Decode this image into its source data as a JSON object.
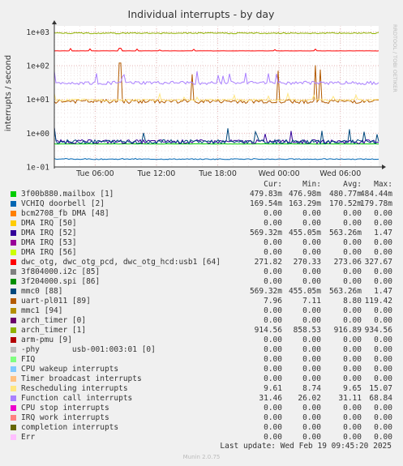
{
  "chart_data": {
    "type": "line",
    "title": "Individual interrupts - by day",
    "ylabel": "interrupts / second",
    "yscale": "log",
    "ylim": [
      0.1,
      1500
    ],
    "y_ticks": [
      "1e-01",
      "1e+00",
      "1e+01",
      "1e+02",
      "1e+03"
    ],
    "x_ticks": [
      "Tue 06:00",
      "Tue 12:00",
      "Tue 18:00",
      "Wed 00:00",
      "Wed 06:00"
    ],
    "watermark": "RRDTOOL / TOBI OETIKER",
    "grid": true,
    "columns": [
      "Cur:",
      "Min:",
      "Avg:",
      "Max:"
    ],
    "series": [
      {
        "name": "3f00b880.mailbox [1]",
        "color": "#00cc00",
        "values": [
          "479.83m",
          "476.98m",
          "480.77m",
          "484.44m"
        ]
      },
      {
        "name": "VCHIQ doorbell [2]",
        "color": "#0066b3",
        "values": [
          "169.54m",
          "163.29m",
          "170.52m",
          "179.78m"
        ]
      },
      {
        "name": "bcm2708_fb DMA [48]",
        "color": "#ff8000",
        "values": [
          "0.00",
          "0.00",
          "0.00",
          "0.00"
        ]
      },
      {
        "name": "DMA IRQ [50]",
        "color": "#ffcc00",
        "values": [
          "0.00",
          "0.00",
          "0.00",
          "0.00"
        ]
      },
      {
        "name": "DMA IRQ [52]",
        "color": "#330099",
        "values": [
          "569.32m",
          "455.05m",
          "563.26m",
          "1.47"
        ]
      },
      {
        "name": "DMA IRQ [53]",
        "color": "#990099",
        "values": [
          "0.00",
          "0.00",
          "0.00",
          "0.00"
        ]
      },
      {
        "name": "DMA IRQ [56]",
        "color": "#ccff00",
        "values": [
          "0.00",
          "0.00",
          "0.00",
          "0.00"
        ]
      },
      {
        "name": "dwc_otg, dwc_otg_pcd, dwc_otg_hcd:usb1 [64]",
        "color": "#ff0000",
        "values": [
          "271.82",
          "270.33",
          "273.06",
          "327.67"
        ]
      },
      {
        "name": "3f804000.i2c [85]",
        "color": "#808080",
        "values": [
          "0.00",
          "0.00",
          "0.00",
          "0.00"
        ]
      },
      {
        "name": "3f204000.spi [86]",
        "color": "#008f00",
        "values": [
          "0.00",
          "0.00",
          "0.00",
          "0.00"
        ]
      },
      {
        "name": "mmc0 [88]",
        "color": "#00487d",
        "values": [
          "569.32m",
          "455.05m",
          "563.26m",
          "1.47"
        ]
      },
      {
        "name": "uart-pl011 [89]",
        "color": "#b35a00",
        "values": [
          "7.96",
          "7.11",
          "8.80",
          "119.42"
        ]
      },
      {
        "name": "mmc1 [94]",
        "color": "#b38f00",
        "values": [
          "0.00",
          "0.00",
          "0.00",
          "0.00"
        ]
      },
      {
        "name": "arch_timer [0]",
        "color": "#6b006b",
        "values": [
          "0.00",
          "0.00",
          "0.00",
          "0.00"
        ]
      },
      {
        "name": "arch_timer [1]",
        "color": "#8fb300",
        "values": [
          "914.56",
          "858.53",
          "916.89",
          "934.56"
        ]
      },
      {
        "name": "arm-pmu [9]",
        "color": "#b30000",
        "values": [
          "0.00",
          "0.00",
          "0.00",
          "0.00"
        ]
      },
      {
        "name": "-phy       usb-001:003:01 [0]",
        "color": "#bebebe",
        "values": [
          "0.00",
          "0.00",
          "0.00",
          "0.00"
        ]
      },
      {
        "name": "FIQ",
        "color": "#80ff80",
        "values": [
          "0.00",
          "0.00",
          "0.00",
          "0.00"
        ]
      },
      {
        "name": "CPU wakeup interrupts",
        "color": "#80c9ff",
        "values": [
          "0.00",
          "0.00",
          "0.00",
          "0.00"
        ]
      },
      {
        "name": "Timer broadcast interrupts",
        "color": "#ffc080",
        "values": [
          "0.00",
          "0.00",
          "0.00",
          "0.00"
        ]
      },
      {
        "name": "Rescheduling interrupts",
        "color": "#ffe680",
        "values": [
          "9.61",
          "8.74",
          "9.65",
          "15.07"
        ]
      },
      {
        "name": "Function call interrupts",
        "color": "#aa80ff",
        "values": [
          "31.46",
          "26.02",
          "31.11",
          "68.84"
        ]
      },
      {
        "name": "CPU stop interrupts",
        "color": "#ee00cc",
        "values": [
          "0.00",
          "0.00",
          "0.00",
          "0.00"
        ]
      },
      {
        "name": "IRQ work interrupts",
        "color": "#ff8080",
        "values": [
          "0.00",
          "0.00",
          "0.00",
          "0.00"
        ]
      },
      {
        "name": "completion interrupts",
        "color": "#666600",
        "values": [
          "0.00",
          "0.00",
          "0.00",
          "0.00"
        ]
      },
      {
        "name": "Err",
        "color": "#ffbfff",
        "values": [
          "0.00",
          "0.00",
          "0.00",
          "0.00"
        ]
      }
    ]
  },
  "footer": {
    "last_update": "Last update: Wed Feb 19 09:45:20 2025",
    "version": "Munin 2.0.75"
  }
}
